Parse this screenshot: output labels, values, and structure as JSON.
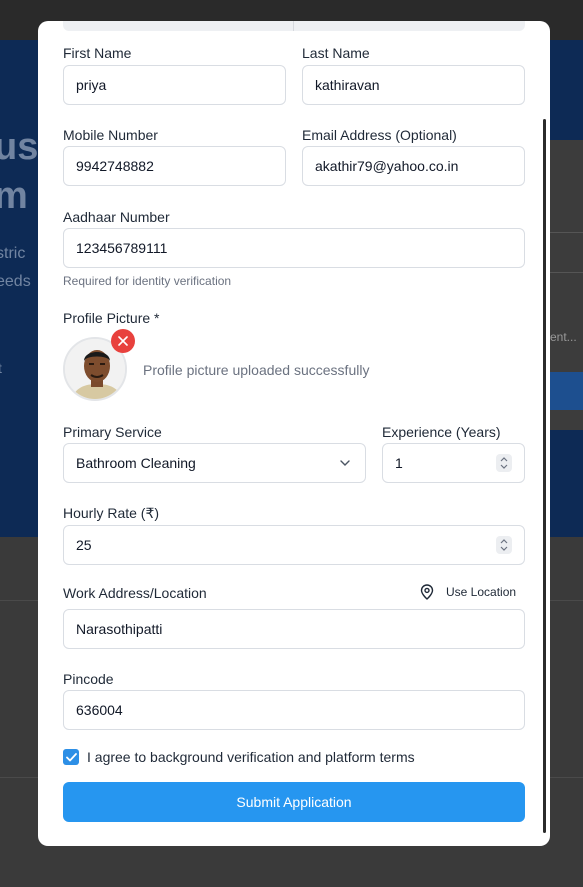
{
  "background": {
    "hero_line1": "us",
    "hero_line2": "m",
    "hero_sub1": "stric",
    "hero_sub2": "eeds",
    "hero_sub3": "t",
    "card_text": "ent..."
  },
  "form": {
    "first_name": {
      "label": "First Name",
      "value": "priya"
    },
    "last_name": {
      "label": "Last Name",
      "value": "kathiravan"
    },
    "mobile": {
      "label": "Mobile Number",
      "value": "9942748882"
    },
    "email": {
      "label": "Email Address (Optional)",
      "value": "akathir79@yahoo.co.in"
    },
    "aadhaar": {
      "label": "Aadhaar Number",
      "value": "123456789111",
      "hint": "Required for identity verification"
    },
    "profile_picture": {
      "label": "Profile Picture *",
      "status": "Profile picture uploaded successfully"
    },
    "primary_service": {
      "label": "Primary Service",
      "value": "Bathroom Cleaning"
    },
    "experience": {
      "label": "Experience (Years)",
      "value": "1"
    },
    "hourly_rate": {
      "label": "Hourly Rate (₹)",
      "value": "25"
    },
    "work_address": {
      "label": "Work Address/Location",
      "use_location": "Use Location",
      "value": "Narasothipatti"
    },
    "pincode": {
      "label": "Pincode",
      "value": "636004"
    },
    "agreement": {
      "label": "I agree to background verification and platform terms",
      "checked": true
    },
    "submit_label": "Submit Application"
  },
  "colors": {
    "accent": "#2696f0",
    "remove": "#e8413d",
    "hero_bg": "#0d2a55",
    "overlay": "#2f2f2f"
  }
}
